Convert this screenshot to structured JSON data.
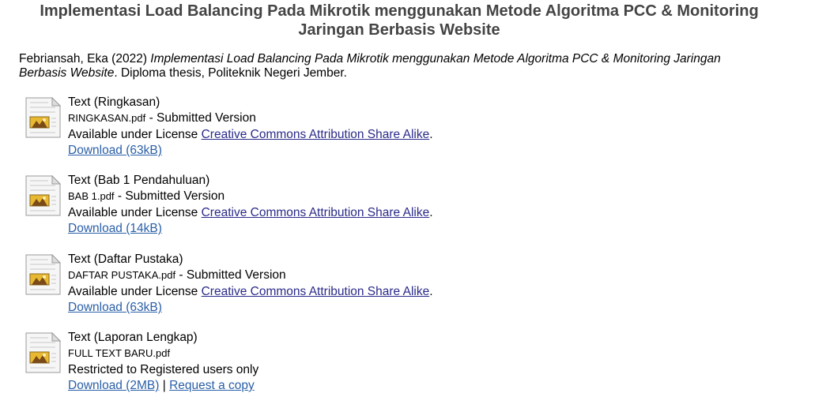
{
  "title_line1": "Implementasi Load Balancing Pada Mikrotik menggunakan Metode Algoritma PCC & Monitoring",
  "title_line2": "Jaringan Berbasis Website",
  "citation": {
    "authors_year": "Febriansah, Eka (2022)",
    "work_title_part1": "Implementasi Load Balancing Pada Mikrotik menggunakan Metode Algoritma PCC & Monitoring Jaringan",
    "work_title_part2": "Berbasis Website",
    "suffix": ". Diploma thesis, Politeknik Negeri Jember."
  },
  "documents": [
    {
      "type_label": "Text (Ringkasan)",
      "filename": "RINGKASAN.pdf",
      "version": " - Submitted Version",
      "license_prefix": "Available under License ",
      "license_link": "Creative Commons Attribution Share Alike",
      "license_suffix": ".",
      "download": "Download (63kB)"
    },
    {
      "type_label": "Text (Bab 1 Pendahuluan)",
      "filename": "BAB 1.pdf",
      "version": " - Submitted Version",
      "license_prefix": "Available under License ",
      "license_link": "Creative Commons Attribution Share Alike",
      "license_suffix": ".",
      "download": "Download (14kB)"
    },
    {
      "type_label": "Text (Daftar Pustaka)",
      "filename": "DAFTAR PUSTAKA.pdf",
      "version": " - Submitted Version",
      "license_prefix": "Available under License ",
      "license_link": "Creative Commons Attribution Share Alike",
      "license_suffix": ".",
      "download": "Download (63kB)"
    },
    {
      "type_label": "Text (Laporan Lengkap)",
      "filename": "FULL TEXT BARU.pdf",
      "restricted": "Restricted to Registered users only",
      "download": "Download (2MB)",
      "separator": " | ",
      "request": "Request a copy"
    }
  ],
  "icons": {
    "document": "document-icon"
  },
  "colors": {
    "title": "#444444",
    "link": "#2a2a8a",
    "download_link": "#2a5fa8"
  }
}
